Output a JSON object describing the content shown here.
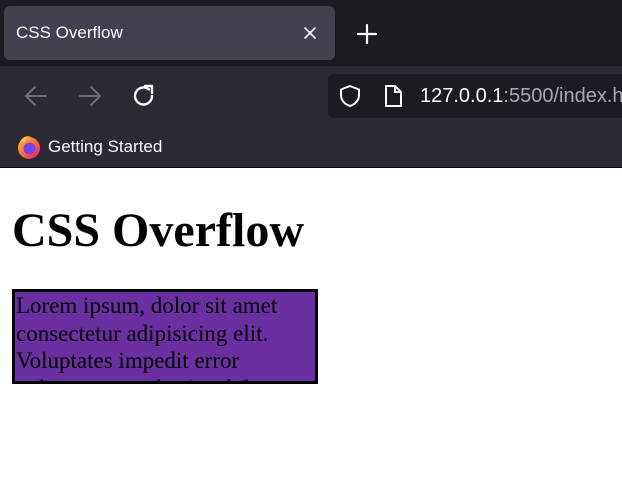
{
  "browser": {
    "tab": {
      "title": "CSS Overflow"
    },
    "url": {
      "host": "127.0.0.1",
      "rest": ":5500/index.h"
    },
    "bookmarks": [
      {
        "label": "Getting Started"
      }
    ],
    "colors": {
      "tabbar": "#1c1b22",
      "toolbar": "#2b2a33",
      "active_tab": "#42414d"
    }
  },
  "page": {
    "heading": "CSS Overflow",
    "box_text": "Lorem ipsum, dolor sit amet consectetur adipisicing elit. Voluptates impedit error voluptatum molestiae dolore repudiandae, nihil laborum.",
    "colors": {
      "box_background": "#6a2fa0",
      "box_border": "#000000"
    }
  }
}
